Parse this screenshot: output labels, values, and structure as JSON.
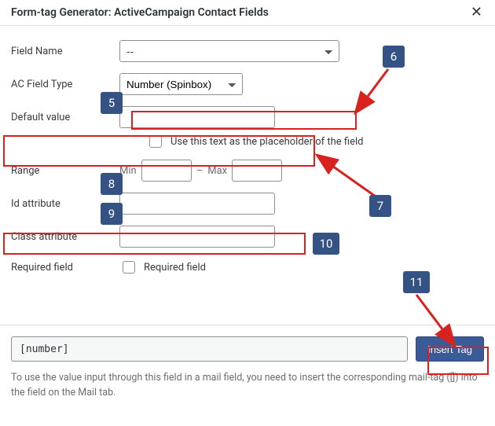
{
  "header": {
    "title": "Form-tag Generator: ActiveCampaign Contact Fields"
  },
  "labels": {
    "field_name": "Field Name",
    "ac_field_type": "AC Field Type",
    "default_value": "Default value",
    "range": "Range",
    "id_attr": "Id attribute",
    "class_attr": "Class attribute",
    "required": "Required field"
  },
  "values": {
    "field_name_selected": "--",
    "ac_field_type_selected": "Number (Spinbox)",
    "default_value": "",
    "placeholder_cb_label": "Use this text as the placeholder of the field",
    "min_label": "Min",
    "max_label": "Max",
    "dash": "–",
    "min_val": "",
    "max_val": "",
    "id_val": "",
    "class_val": "",
    "required_cb_label": "Required field"
  },
  "badges": {
    "b5": "5",
    "b6": "6",
    "b7": "7",
    "b8": "8",
    "b9": "9",
    "b10": "10",
    "b11": "11"
  },
  "footer": {
    "tag_value": "[number]",
    "insert_label": "Insert Tag",
    "hint": "To use the value input through this field in a mail field, you need to insert the corresponding mail-tag ([]) into the field on the Mail tab."
  }
}
